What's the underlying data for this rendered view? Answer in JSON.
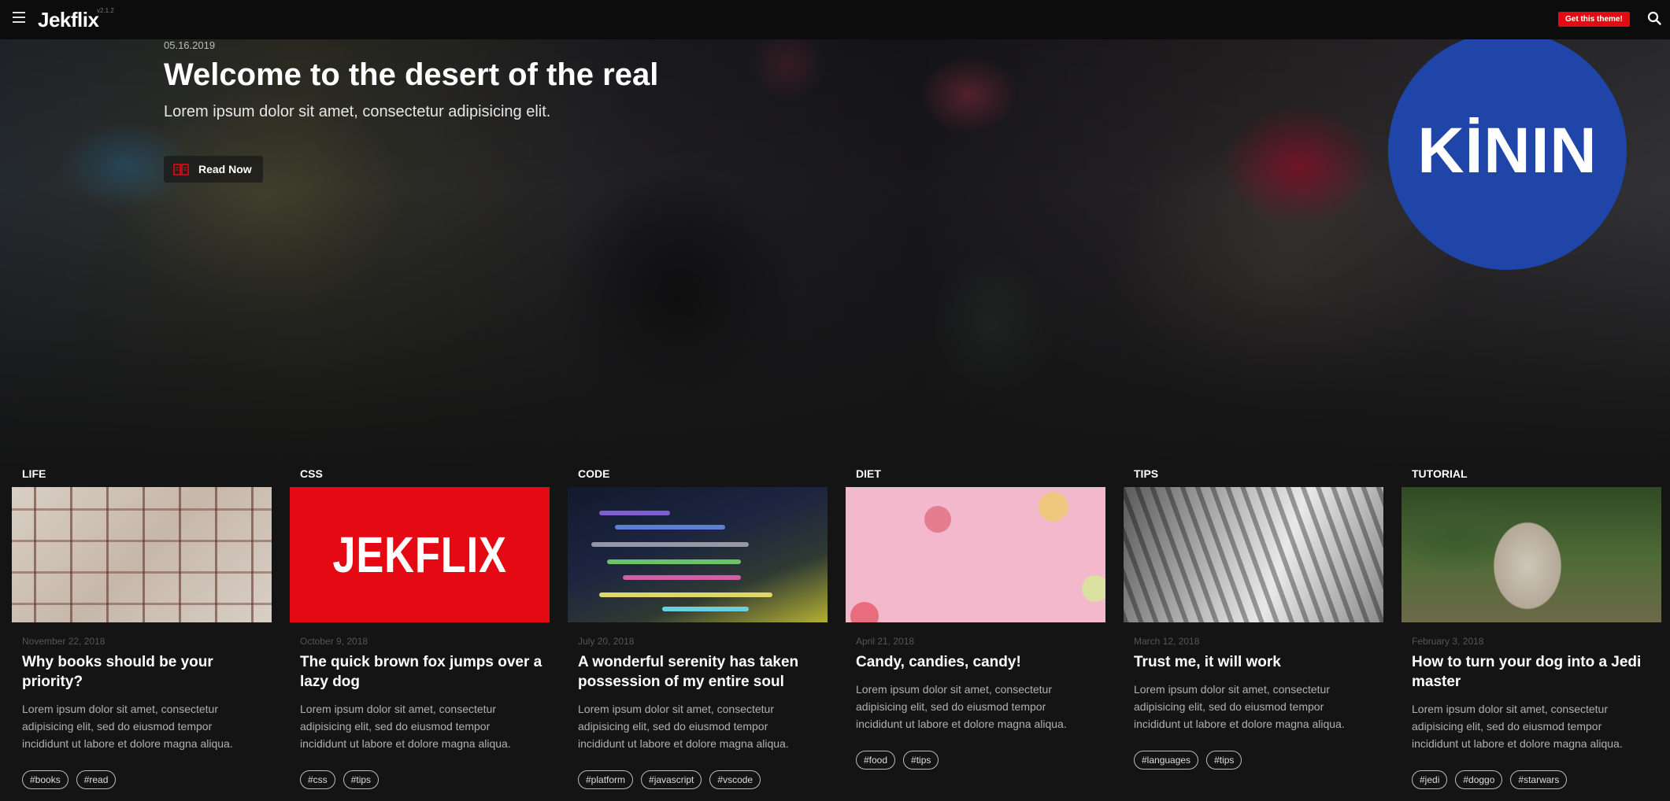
{
  "nav": {
    "logo": "Jekflix",
    "version": "v2.1.2",
    "cta": "Get this theme!",
    "menu_icon": "hamburger-menu-icon",
    "search_icon": "search-icon"
  },
  "hero": {
    "date": "05.16.2019",
    "title": "Welcome to the desert of the real",
    "subtitle": "Lorem ipsum dolor sit amet, consectetur adipisicing elit.",
    "read_now": "Read Now",
    "read_icon": "book-icon"
  },
  "badge": {
    "text": "KİNIN",
    "color": "#1f45a8"
  },
  "colors": {
    "accent": "#e50914",
    "background": "#141414"
  },
  "cards": [
    {
      "category": "LIFE",
      "image": "open-books-photo",
      "date": "November 22, 2018",
      "title": "Why books should be your priority?",
      "text": "Lorem ipsum dolor sit amet, consectetur adipisicing elit, sed do eiusmod tempor incididunt ut labore et dolore magna aliqua.",
      "tags": [
        "#books",
        "#read"
      ]
    },
    {
      "category": "CSS",
      "image": "jekflix-logo-image",
      "image_text": "JEKFLIX",
      "date": "October 9, 2018",
      "title": "The quick brown fox jumps over a lazy dog",
      "text": "Lorem ipsum dolor sit amet, consectetur adipisicing elit, sed do eiusmod tempor incididunt ut labore et dolore magna aliqua.",
      "tags": [
        "#css",
        "#tips"
      ]
    },
    {
      "category": "CODE",
      "image": "code-screen-photo",
      "date": "July 20, 2018",
      "title": "A wonderful serenity has taken possession of my entire soul",
      "text": "Lorem ipsum dolor sit amet, consectetur adipisicing elit, sed do eiusmod tempor incididunt ut labore et dolore magna aliqua.",
      "tags": [
        "#platform",
        "#javascript",
        "#vscode"
      ]
    },
    {
      "category": "DIET",
      "image": "candy-pink-photo",
      "date": "April 21, 2018",
      "title": "Candy, candies, candy!",
      "text": "Lorem ipsum dolor sit amet, consectetur adipisicing elit, sed do eiusmod tempor incididunt ut labore et dolore magna aliqua.",
      "tags": [
        "#food",
        "#tips"
      ]
    },
    {
      "category": "TIPS",
      "image": "dollar-bills-photo",
      "date": "March 12, 2018",
      "title": "Trust me, it will work",
      "text": "Lorem ipsum dolor sit amet, consectetur adipisicing elit, sed do eiusmod tempor incididunt ut labore et dolore magna aliqua.",
      "tags": [
        "#languages",
        "#tips"
      ]
    },
    {
      "category": "TUTORIAL",
      "image": "pug-blanket-photo",
      "date": "February 3, 2018",
      "title": "How to turn your dog into a Jedi master",
      "text": "Lorem ipsum dolor sit amet, consectetur adipisicing elit, sed do eiusmod tempor incididunt ut labore et dolore magna aliqua.",
      "tags": [
        "#jedi",
        "#doggo",
        "#starwars"
      ]
    }
  ]
}
